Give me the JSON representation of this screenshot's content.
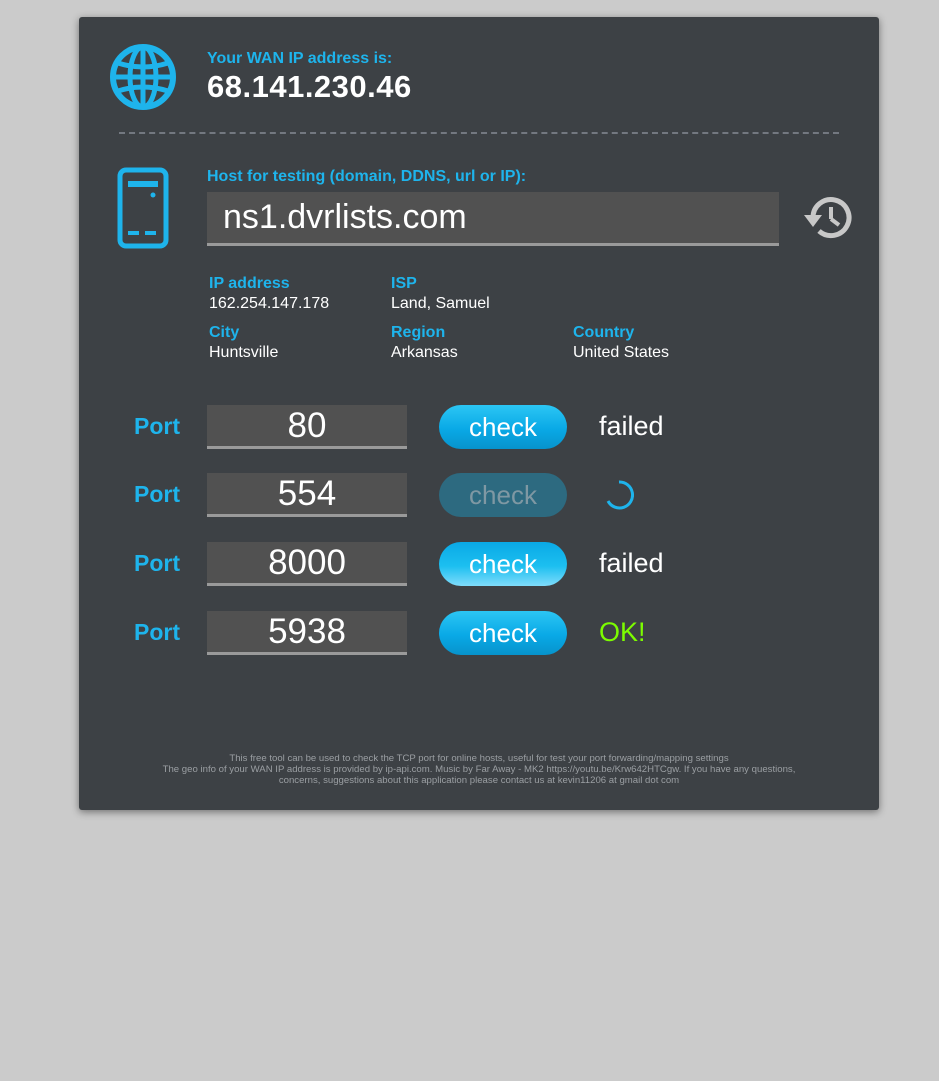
{
  "wan": {
    "label": "Your WAN IP address is:",
    "ip": "68.141.230.46"
  },
  "host": {
    "label": "Host for testing (domain, DDNS, url or IP):",
    "value": "ns1.dvrlists.com"
  },
  "geo": {
    "ip_label": "IP address",
    "ip_value": "162.254.147.178",
    "isp_label": "ISP",
    "isp_value": "Land, Samuel",
    "city_label": "City",
    "city_value": "Huntsville",
    "region_label": "Region",
    "region_value": "Arkansas",
    "country_label": "Country",
    "country_value": "United States"
  },
  "ports": [
    {
      "label": "Port",
      "value": "80",
      "button": "check",
      "result": "failed",
      "status": "failed"
    },
    {
      "label": "Port",
      "value": "554",
      "button": "check",
      "result": "",
      "status": "checking"
    },
    {
      "label": "Port",
      "value": "8000",
      "button": "check",
      "result": "failed",
      "status": "failed"
    },
    {
      "label": "Port",
      "value": "5938",
      "button": "check",
      "result": "OK!",
      "status": "ok"
    }
  ],
  "colors": {
    "accent": "#1eb4ec",
    "panel": "#3d4145",
    "ok": "#7cfc00",
    "failed": "#ffffff"
  },
  "footer": {
    "line1": "This free tool can be used to check the TCP port for online hosts, useful for test your port forwarding/mapping settings",
    "line2": "The geo info of your WAN IP address is provided by ip-api.com. Music by Far Away - MK2 https://youtu.be/Krw642HTCgw. If you have any questions,",
    "line3": "concerns, suggestions about this application please contact us at kevin11206 at gmail dot com"
  }
}
